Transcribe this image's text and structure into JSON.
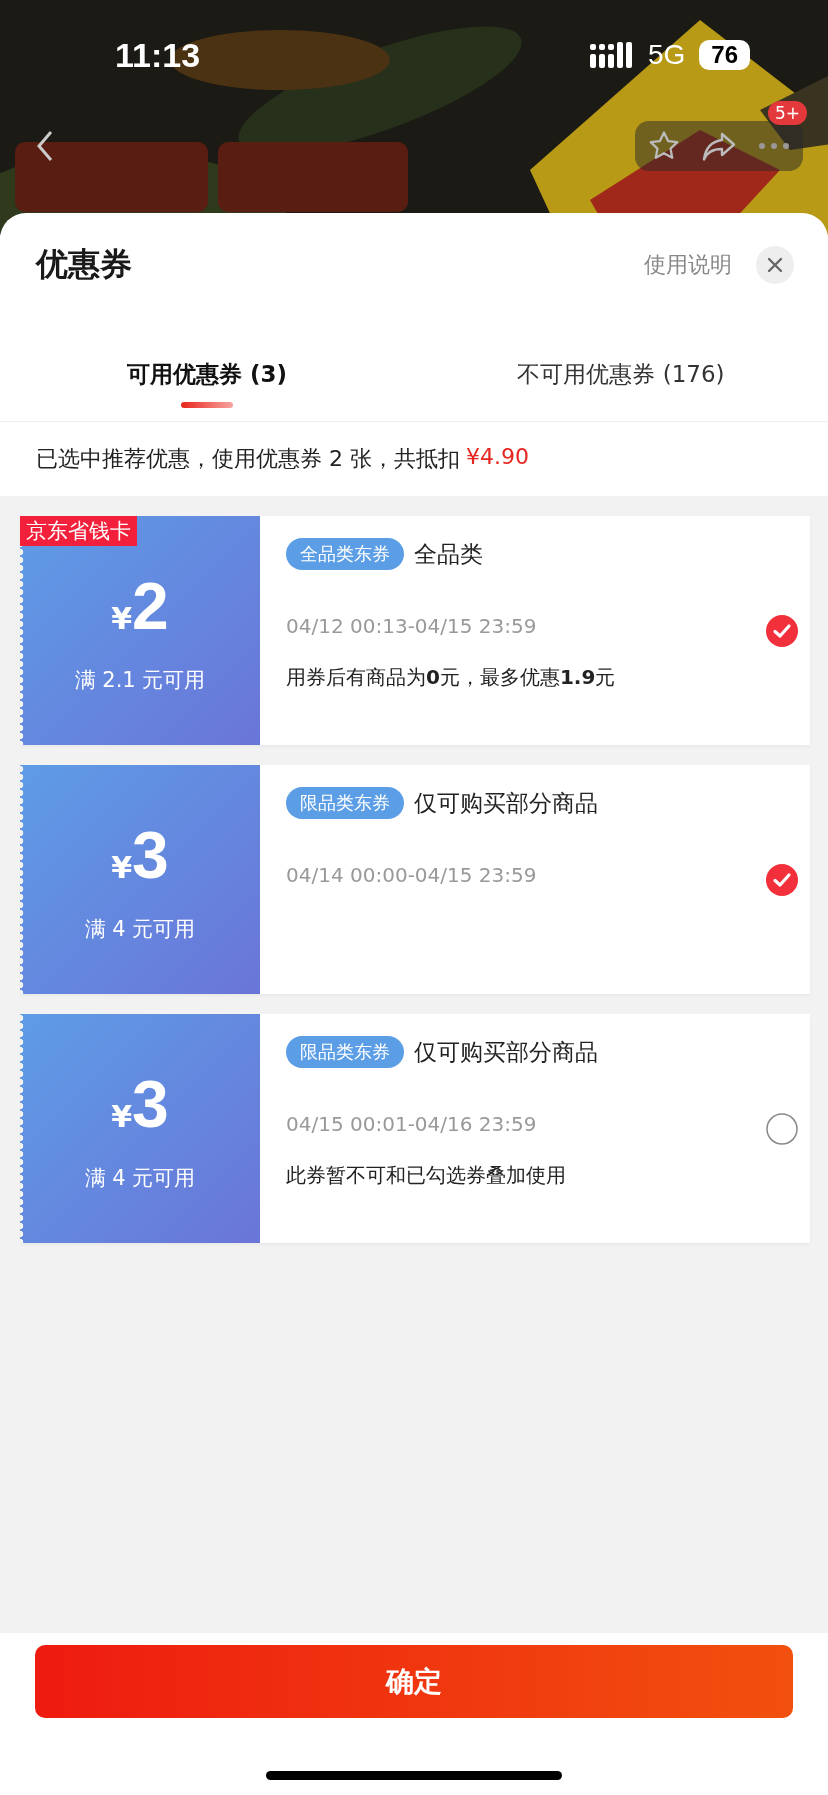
{
  "status_bar": {
    "time": "11:13",
    "network": "5G",
    "battery": "76"
  },
  "nav": {
    "more_badge": "5+"
  },
  "sheet": {
    "title": "优惠券",
    "help_link": "使用说明"
  },
  "tabs": [
    {
      "label": "可用优惠券 (3)",
      "selected": true
    },
    {
      "label": "不可用优惠券 (176)",
      "selected": false
    }
  ],
  "summary": {
    "text": "已选中推荐优惠，使用优惠券 2 张，共抵扣",
    "amount": "¥4.90"
  },
  "coupons": [
    {
      "badge": "京东省钱卡",
      "currency": "¥",
      "amount": "2",
      "condition": "满 2.1 元可用",
      "tag": "全品类东券",
      "title": "全品类",
      "validity": "04/12 00:13-04/15 23:59",
      "note": "用券后有商品为**0**元，最多优惠**1.9**元",
      "selected": true
    },
    {
      "currency": "¥",
      "amount": "3",
      "condition": "满 4 元可用",
      "tag": "限品类东券",
      "title": "仅可购买部分商品",
      "validity": "04/14 00:00-04/15 23:59",
      "selected": true
    },
    {
      "currency": "¥",
      "amount": "3",
      "condition": "满 4 元可用",
      "tag": "限品类东券",
      "title": "仅可购买部分商品",
      "validity": "04/15 00:01-04/16 23:59",
      "note": "此券暂不可和已勾选券叠加使用",
      "selected": false
    }
  ],
  "confirm_button": "确定"
}
